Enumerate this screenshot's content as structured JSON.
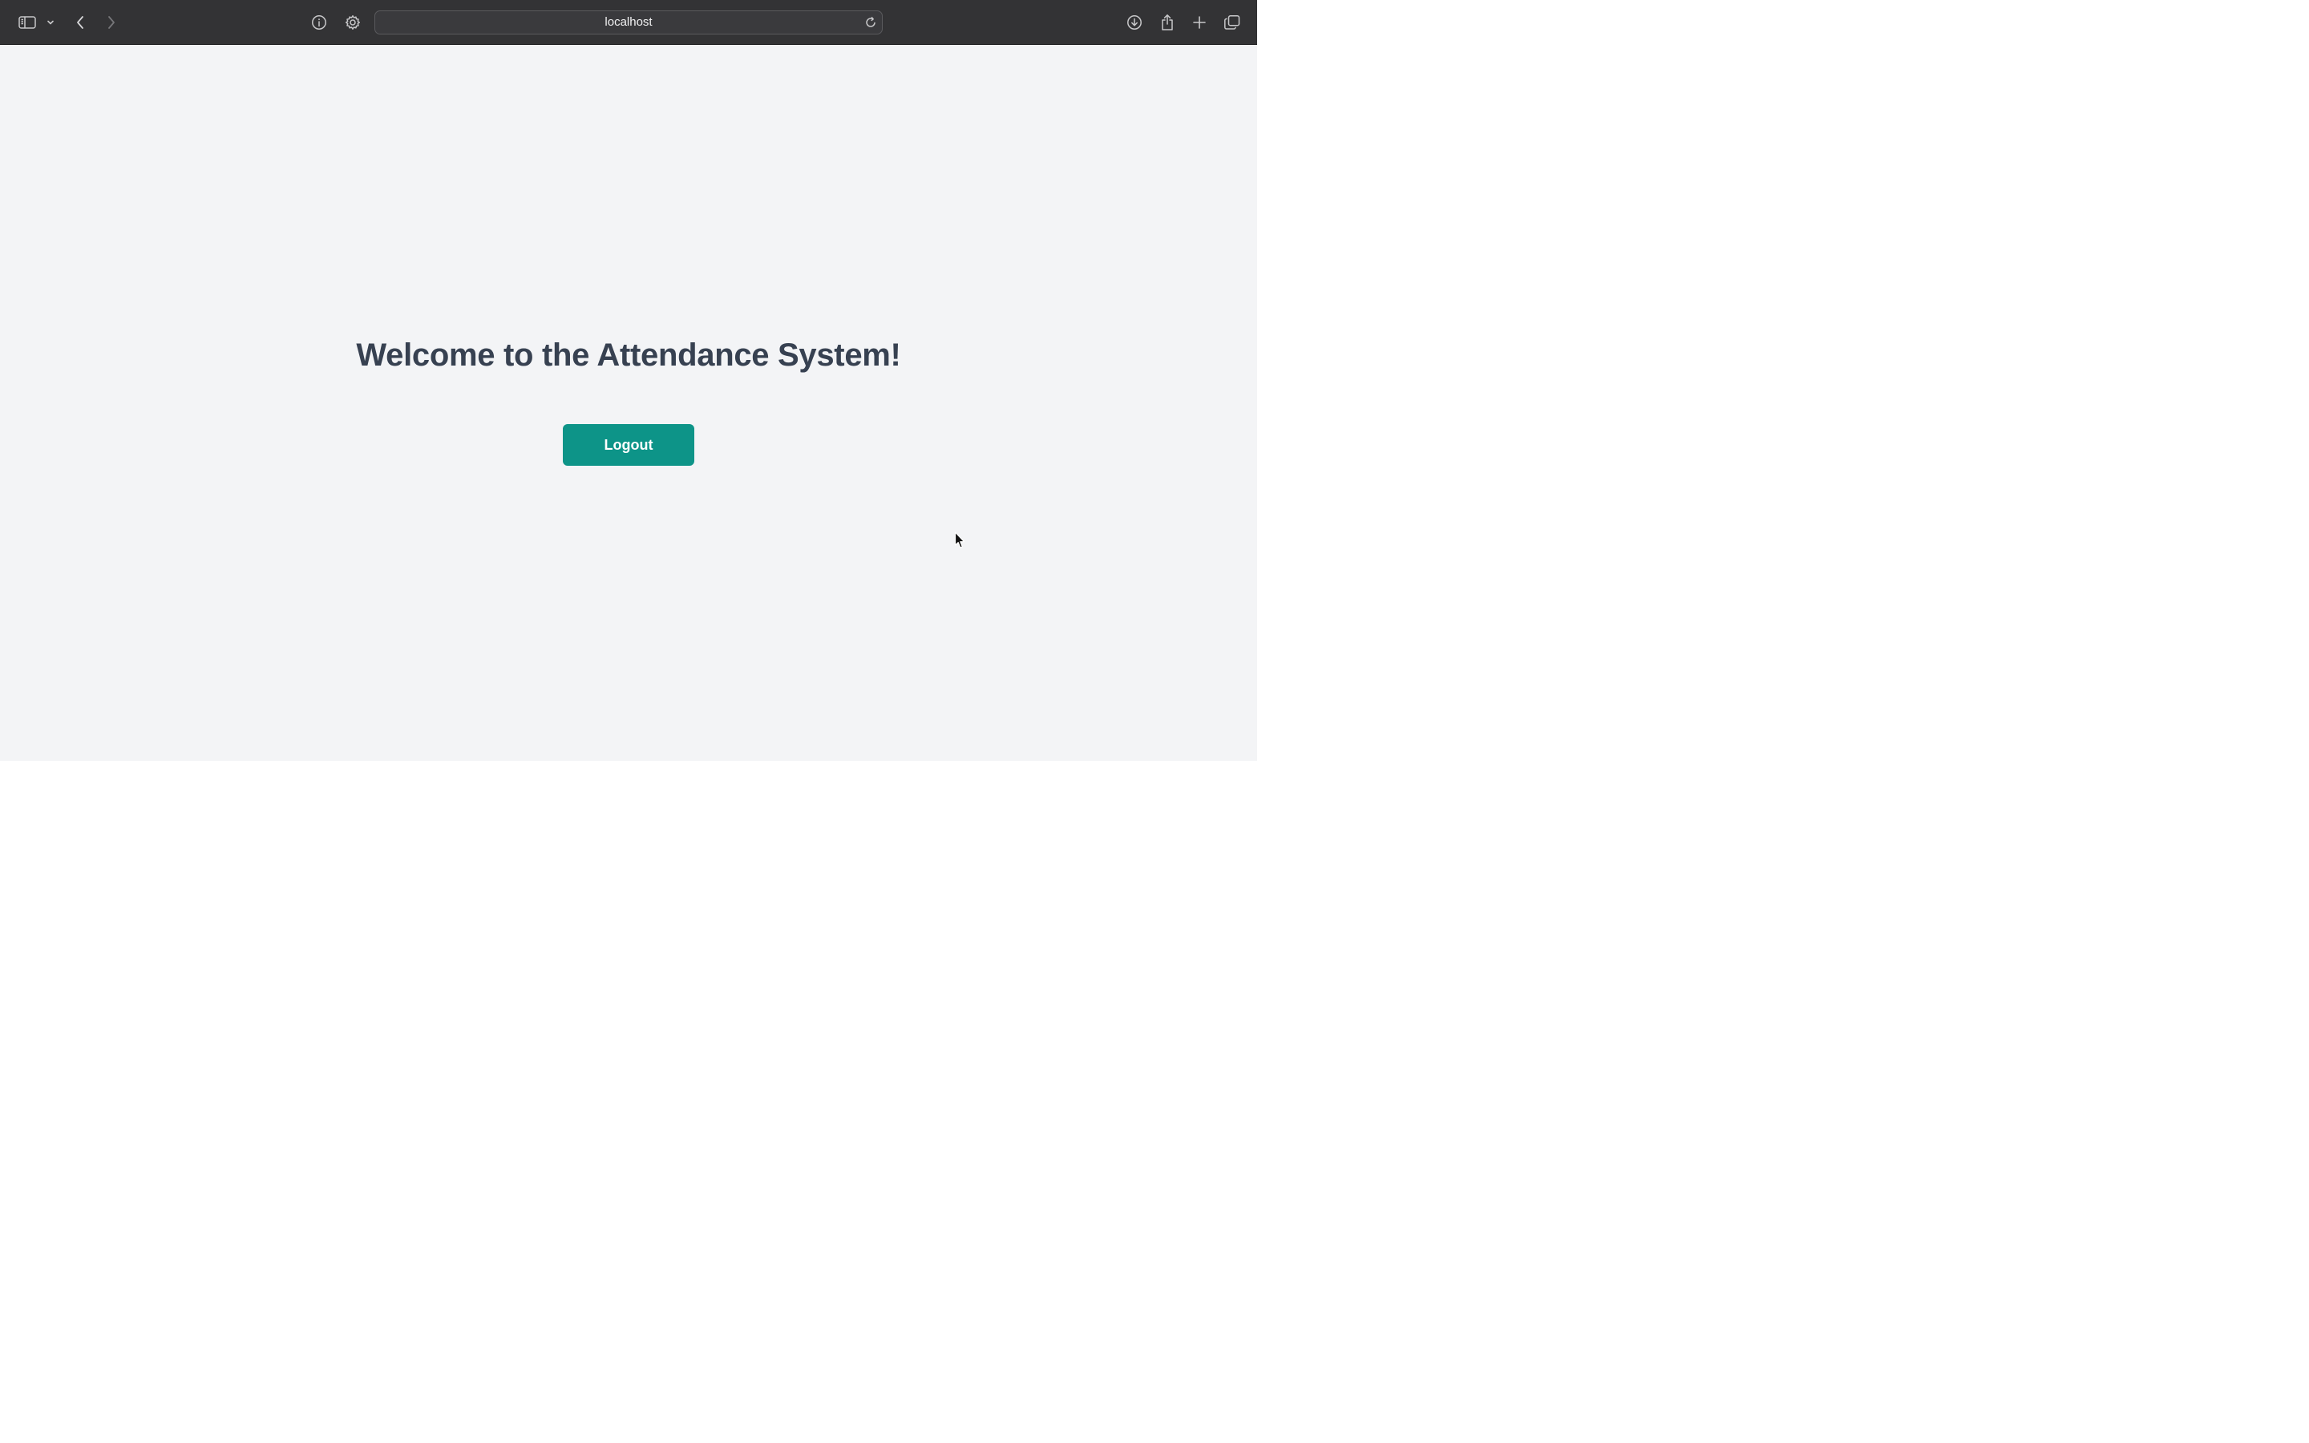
{
  "browser": {
    "url": "localhost",
    "icons": {
      "sidebar": "sidebar-icon",
      "sidebar_menu": "chevron-down-icon",
      "back": "chevron-left-icon",
      "forward": "chevron-right-icon",
      "info": "info-icon",
      "settings": "gear-icon",
      "reload": "reload-icon",
      "download": "download-icon",
      "share": "share-icon",
      "new_tab": "plus-icon",
      "tabs": "tabs-overview-icon"
    }
  },
  "page": {
    "heading": "Welcome to the Attendance System!",
    "logout_label": "Logout",
    "colors": {
      "background": "#f3f4f6",
      "heading": "#374151",
      "button": "#0d9488"
    }
  }
}
